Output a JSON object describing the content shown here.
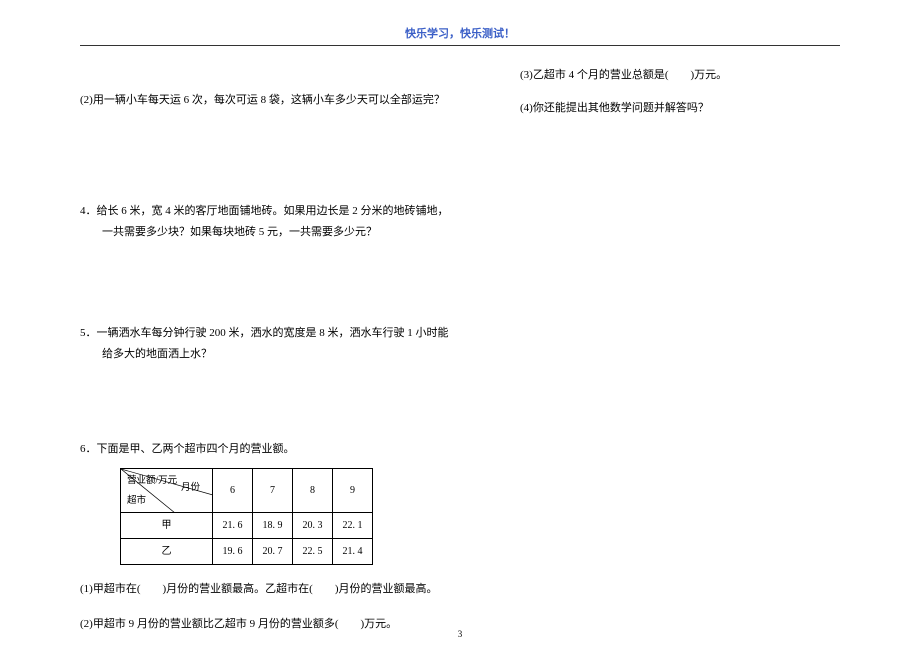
{
  "header": "快乐学习，快乐测试！",
  "q2": "(2)用一辆小车每天运 6 次，每次可运 8 袋，这辆小车多少天可以全部运完？",
  "q4": {
    "num": "4．",
    "line1": "给长 6 米，宽 4 米的客厅地面铺地砖。如果用边长是 2 分米的地砖铺地，",
    "line2": "一共需要多少块？如果每块地砖 5 元，一共需要多少元？"
  },
  "q5": {
    "num": "5．",
    "line1": "一辆洒水车每分钟行驶 200 米，洒水的宽度是 8 米，洒水车行驶 1 小时能",
    "line2": "给多大的地面洒上水？"
  },
  "q6": {
    "num": "6．",
    "title": "下面是甲、乙两个超市四个月的营业额。",
    "diag": {
      "top": "营业额/万元",
      "right": "月份",
      "bottom": "超市"
    },
    "months": [
      "6",
      "7",
      "8",
      "9"
    ],
    "rows": [
      {
        "name": "甲",
        "vals": [
          "21. 6",
          "18. 9",
          "20. 3",
          "22. 1"
        ]
      },
      {
        "name": "乙",
        "vals": [
          "19. 6",
          "20. 7",
          "22. 5",
          "21. 4"
        ]
      }
    ],
    "sub1": "(1)甲超市在(　　)月份的营业额最高。乙超市在(　　)月份的营业额最高。",
    "sub2": "(2)甲超市 9 月份的营业额比乙超市 9 月份的营业额多(　　)万元。"
  },
  "r1": "(3)乙超市 4 个月的营业总额是(　　)万元。",
  "r2": "(4)你还能提出其他数学问题并解答吗？",
  "page": "3",
  "chart_data": {
    "type": "table",
    "title": "甲、乙两个超市四个月的营业额 (万元)",
    "categories": [
      "6",
      "7",
      "8",
      "9"
    ],
    "series": [
      {
        "name": "甲",
        "values": [
          21.6,
          18.9,
          20.3,
          22.1
        ]
      },
      {
        "name": "乙",
        "values": [
          19.6,
          20.7,
          22.5,
          21.4
        ]
      }
    ]
  }
}
